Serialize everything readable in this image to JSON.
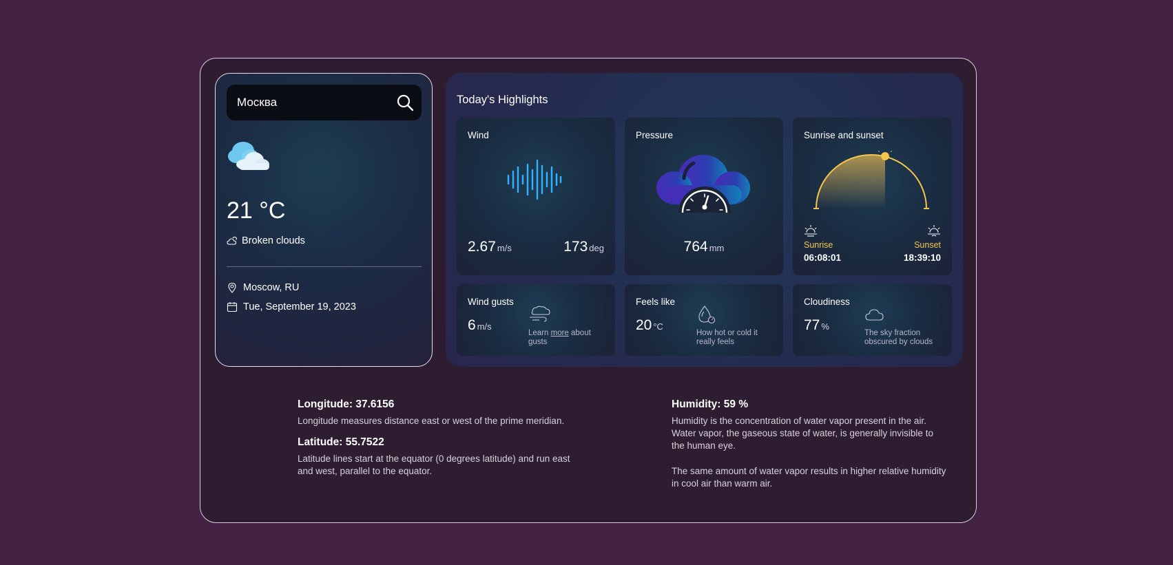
{
  "search": {
    "value": "Москва"
  },
  "current": {
    "temperature": "21 °C",
    "description": "Broken clouds",
    "location": "Moscow, RU",
    "date": "Tue, September 19, 2023"
  },
  "highlights": {
    "title": "Today's Highlights",
    "wind": {
      "label": "Wind",
      "speed": "2.67",
      "speed_unit": "m/s",
      "direction": "173",
      "direction_unit": "deg"
    },
    "pressure": {
      "label": "Pressure",
      "value": "764",
      "unit": "mm"
    },
    "sun": {
      "label": "Sunrise and sunset",
      "sunrise_label": "Sunrise",
      "sunrise_time": "06:08:01",
      "sunset_label": "Sunset",
      "sunset_time": "18:39:10"
    },
    "gusts": {
      "label": "Wind gusts",
      "value": "6",
      "unit": "m/s",
      "note_pre": "Learn ",
      "note_link": "more",
      "note_post": " about gusts"
    },
    "feels": {
      "label": "Feels like",
      "value": "20",
      "unit": "°C",
      "note": "How hot or cold it really feels"
    },
    "cloudiness": {
      "label": "Cloudiness",
      "value": "77",
      "unit": "%",
      "note": "The sky fraction obscured by clouds"
    }
  },
  "info": {
    "longitude_title": "Longitude: 37.6156",
    "longitude_text": "Longitude measures distance east or west of the prime meridian.",
    "latitude_title": "Latitude: 55.7522",
    "latitude_text": "Latitude lines start at the equator (0 degrees latitude) and run east and west, parallel to the equator.",
    "humidity_title": "Humidity: 59 %",
    "humidity_text_1": "Humidity is the concentration of water vapor present in the air. Water vapor, the gaseous state of water, is generally invisible to the human eye.",
    "humidity_text_2": "The same amount of water vapor results in higher relative humidity in cool air than warm air."
  },
  "colors": {
    "background": "#442244",
    "frame": "#2e1c30",
    "accent_sun": "#f7c54e",
    "wind_wave": "#33b3ff"
  },
  "icons": [
    "search-icon",
    "broken-clouds-icon",
    "cloud-outline-icon",
    "location-pin-icon",
    "calendar-icon",
    "sound-wave-icon",
    "pressure-gauge-icon",
    "sunrise-icon",
    "sunset-icon",
    "wind-icon",
    "thermometer-drop-icon",
    "cloud-icon"
  ]
}
